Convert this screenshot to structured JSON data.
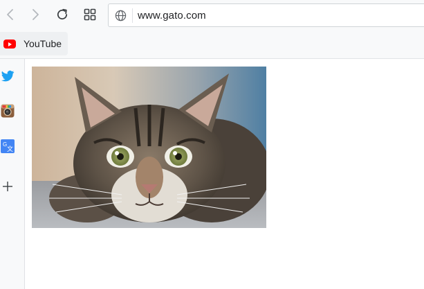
{
  "toolbar": {
    "back_icon": "back-arrow-icon",
    "forward_icon": "forward-arrow-icon",
    "reload_icon": "reload-icon",
    "tabs_icon": "tab-grid-icon"
  },
  "address_bar": {
    "url": "www.gato.com",
    "site_icon": "globe-icon"
  },
  "bookmarks": [
    {
      "label": "YouTube",
      "icon": "youtube-icon",
      "color": "#ff0000"
    }
  ],
  "sidebar": {
    "items": [
      {
        "name": "twitter",
        "icon": "twitter-icon",
        "color": "#1da1f2"
      },
      {
        "name": "instagram",
        "icon": "instagram-icon",
        "color": "#8a5a3a"
      },
      {
        "name": "translate",
        "icon": "translate-icon",
        "color": "#4285f4"
      },
      {
        "name": "add",
        "icon": "plus-icon",
        "color": "#3c4043"
      }
    ]
  },
  "content": {
    "image": "cat-photo"
  },
  "colors": {
    "chrome_bg": "#f8f9fa",
    "icon_gray": "#5f6368"
  }
}
